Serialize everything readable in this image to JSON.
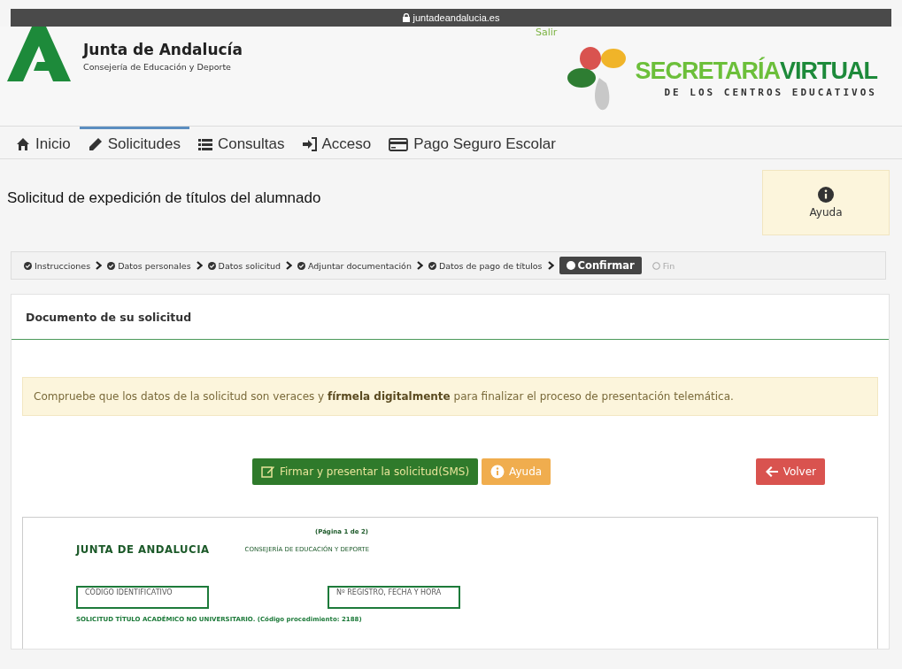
{
  "browser_bar": {
    "url": "juntadeandalucia.es"
  },
  "header": {
    "title": "Junta de Andalucía",
    "subtitle": "Consejería de Educación y Deporte",
    "logout": "Salir",
    "brand": {
      "word_1": "SECRETARÍA",
      "word_2": "VIRTUAL",
      "tagline": "DE LOS CENTROS EDUCATIVOS"
    }
  },
  "nav": [
    {
      "label": "Inicio",
      "selected": false
    },
    {
      "label": "Solicitudes",
      "selected": true
    },
    {
      "label": "Consultas",
      "selected": false
    },
    {
      "label": "Acceso",
      "selected": false
    },
    {
      "label": "Pago Seguro Escolar",
      "selected": false
    }
  ],
  "page_title": "Solicitud de expedición de títulos del alumnado",
  "help_box": {
    "label": "Ayuda"
  },
  "steps": [
    {
      "label": "Instrucciones",
      "kind": "done"
    },
    {
      "label": "Datos personales",
      "kind": "done"
    },
    {
      "label": "Datos solicitud",
      "kind": "done"
    },
    {
      "label": "Adjuntar documentación",
      "kind": "done"
    },
    {
      "label": "Datos de pago de títulos",
      "kind": "done"
    },
    {
      "label": "Confirmar",
      "kind": "current"
    },
    {
      "label": "Fin",
      "kind": "pending"
    }
  ],
  "panel": {
    "title": "Documento de su solicitud",
    "alert": "Compruebe que los datos de la solicitud son veraces y **fírmela digitalmente** para finalizar el proceso de presentación telemática.",
    "buttons": [
      {
        "label": "Firmar y presentar la solicitud(SMS)",
        "kind": "success"
      },
      {
        "label": "Ayuda",
        "kind": "warning"
      },
      {
        "label": "Volver",
        "kind": "danger"
      }
    ],
    "document": {
      "page": "(Página 1  de  2)",
      "org": "JUNTA DE ANDALUCIA",
      "department": "CONSEJERÍA  DE EDUCACIÓN Y DEPORTE",
      "fields": [
        "CÓDIGO IDENTIFICATIVO",
        "Nº REGISTRO, FECHA Y HORA"
      ],
      "heading": "SOLICITUD TÍTULO ACADÉMICO NO UNIVERSITARIO. (Código procedimiento: 2188)"
    }
  }
}
